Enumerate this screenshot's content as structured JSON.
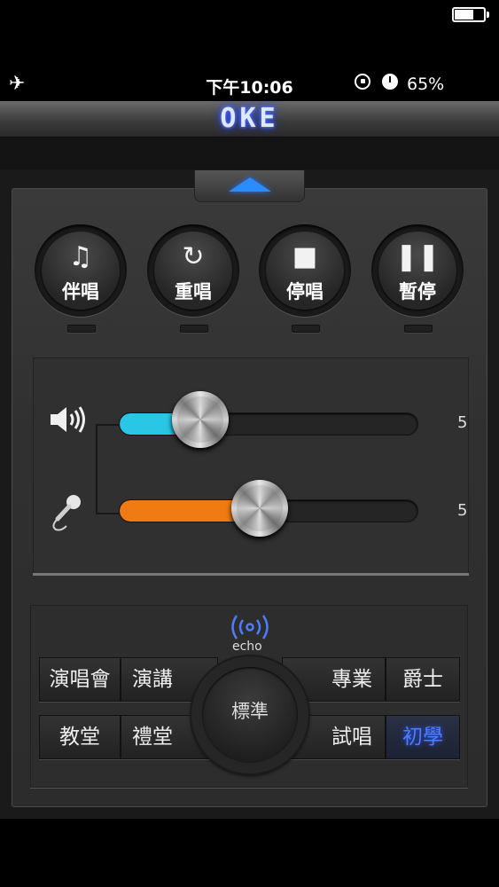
{
  "status_bar": {
    "time": "下午10:06",
    "battery_percent": "65%",
    "battery_level": 0.65,
    "icons": [
      "airplane-icon",
      "rotation-lock-icon",
      "alarm-icon",
      "battery-icon"
    ]
  },
  "header": {
    "logo": "OKE"
  },
  "controls": [
    {
      "label": "伴唱",
      "icon": "music-note-icon"
    },
    {
      "label": "重唱",
      "icon": "replay-icon"
    },
    {
      "label": "停唱",
      "icon": "stop-icon"
    },
    {
      "label": "暫停",
      "icon": "pause-icon"
    }
  ],
  "sliders": {
    "music_volume": {
      "value": "5",
      "level": 0.23,
      "color": "#29c6e6",
      "icon": "speaker-icon"
    },
    "mic_volume": {
      "value": "5",
      "level": 0.43,
      "color": "#f07b12",
      "icon": "microphone-icon"
    }
  },
  "echo": {
    "label": "echo",
    "center": "標準",
    "modes_left": [
      {
        "label": "演唱會",
        "active": false
      },
      {
        "label": "演講",
        "active": false
      },
      {
        "label": "教堂",
        "active": false
      },
      {
        "label": "禮堂",
        "active": false
      }
    ],
    "modes_right": [
      {
        "label": "專業",
        "active": false
      },
      {
        "label": "爵士",
        "active": false
      },
      {
        "label": "試唱",
        "active": false
      },
      {
        "label": "初學",
        "active": true
      }
    ],
    "accent_color": "#4d7cff"
  }
}
